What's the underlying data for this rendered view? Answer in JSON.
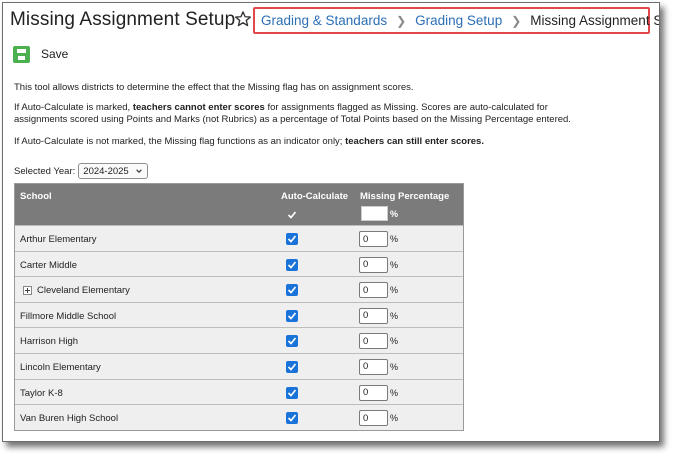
{
  "page": {
    "title": "Missing Assignment Setup",
    "favorite_icon": "star-outline-icon"
  },
  "breadcrumb": {
    "items": [
      {
        "label": "Grading & Standards",
        "link": true
      },
      {
        "label": "Grading Setup",
        "link": true
      },
      {
        "label": "Missing Assignment Setup",
        "link": false
      }
    ],
    "separator_icon": "chevron-right-icon",
    "highlight_color": "#e0484b"
  },
  "toolbar": {
    "save_label": "Save",
    "save_icon": "floppy-disk-icon"
  },
  "description": {
    "p1": "This tool allows districts to determine the effect that the Missing flag has on assignment scores.",
    "p2_a": "If Auto-Calculate is marked, ",
    "p2_b": "teachers cannot enter scores",
    "p2_c": " for assignments flagged as Missing. Scores are auto-calculated for",
    "p2_d": "assignments scored using Points and Marks (not Rubrics) as a percentage of Total Points based on the Missing Percentage entered.",
    "p3_a": "If Auto-Calculate is not marked, the Missing flag functions as an indicator only; ",
    "p3_b": "teachers can still enter scores."
  },
  "year": {
    "label": "Selected Year:",
    "selected": "2024-2025"
  },
  "table": {
    "headers": {
      "school": "School",
      "auto": "Auto-Calculate",
      "missing": "Missing Percentage",
      "percent_sign": "%"
    },
    "header_all_checked": true,
    "header_percentage": "",
    "rows": [
      {
        "school": "Arthur Elementary",
        "auto": true,
        "percentage": "0",
        "expandable": false
      },
      {
        "school": "Carter Middle",
        "auto": true,
        "percentage": "0",
        "expandable": false
      },
      {
        "school": "Cleveland Elementary",
        "auto": true,
        "percentage": "0",
        "expandable": true
      },
      {
        "school": "Fillmore Middle School",
        "auto": true,
        "percentage": "0",
        "expandable": false
      },
      {
        "school": "Harrison High",
        "auto": true,
        "percentage": "0",
        "expandable": false
      },
      {
        "school": "Lincoln Elementary",
        "auto": true,
        "percentage": "0",
        "expandable": false
      },
      {
        "school": "Taylor K-8",
        "auto": true,
        "percentage": "0",
        "expandable": false
      },
      {
        "school": "Van Buren High School",
        "auto": true,
        "percentage": "0",
        "expandable": false
      }
    ]
  },
  "colors": {
    "link": "#2b6fb5",
    "checkbox": "#1a73d9",
    "table_header": "#7b7b7b",
    "row_bg": "#efefef",
    "save_green": "#4caf50"
  }
}
